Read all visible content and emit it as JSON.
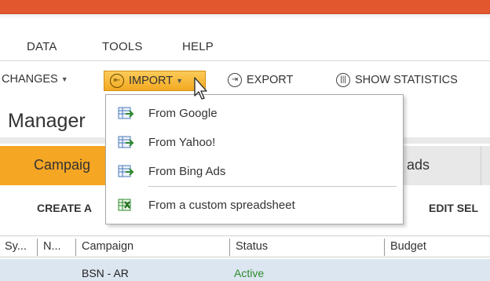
{
  "menu": {
    "items": [
      "DATA",
      "TOOLS",
      "HELP"
    ]
  },
  "toolbar": {
    "changes_label": "CHANGES",
    "import_label": "IMPORT",
    "export_label": "EXPORT",
    "show_statistics_label": "SHOW STATISTICS",
    "import_icon": "import-circle-arrow-icon",
    "export_icon": "export-circle-arrow-icon",
    "statistics_icon": "statistics-bars-icon"
  },
  "import_dropdown": {
    "items": [
      {
        "label": "From Google",
        "icon": "spreadsheet-import-icon"
      },
      {
        "label": "From Yahoo!",
        "icon": "spreadsheet-import-icon"
      },
      {
        "label": "From Bing Ads",
        "icon": "spreadsheet-import-icon"
      },
      {
        "label": "From a custom spreadsheet",
        "icon": "excel-spreadsheet-icon"
      }
    ]
  },
  "page": {
    "title_partial": "Manager"
  },
  "tabs": {
    "campaigns_partial": "Campaig",
    "ads_partial": "ads"
  },
  "actions": {
    "create_partial": "CREATE A",
    "edit_partial": "EDIT SEL"
  },
  "grid": {
    "columns": [
      "Sy...",
      "N...",
      "Campaign",
      "Status",
      "Budget"
    ],
    "rows": [
      {
        "campaign": "BSN - AR",
        "status": "Active"
      }
    ]
  },
  "colors": {
    "accent_orange": "#f5a623",
    "title_bar": "#e2572e",
    "selected_row": "#dce6f1",
    "active_status": "#2e8b2e"
  }
}
